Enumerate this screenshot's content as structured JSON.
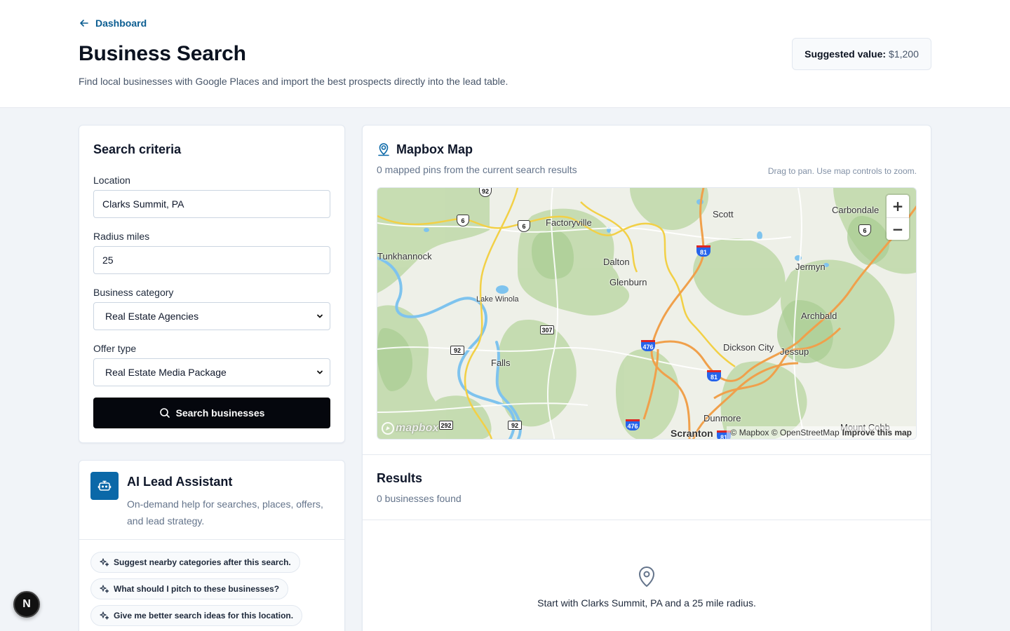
{
  "header": {
    "back_label": "Dashboard",
    "title": "Business Search",
    "subtitle": "Find local businesses with Google Places and import the best prospects directly into the lead table.",
    "suggested_label": "Suggested value:",
    "suggested_value": "$1,200"
  },
  "criteria": {
    "title": "Search criteria",
    "location_label": "Location",
    "location_value": "Clarks Summit, PA",
    "radius_label": "Radius miles",
    "radius_value": "25",
    "category_label": "Business category",
    "category_value": "Real Estate Agencies",
    "offer_label": "Offer type",
    "offer_value": "Real Estate Media Package",
    "search_button": "Search businesses"
  },
  "assistant": {
    "title": "AI Lead Assistant",
    "description": "On-demand help for searches, places, offers, and lead strategy.",
    "suggestions": [
      "Suggest nearby categories after this search.",
      "What should I pitch to these businesses?",
      "Give me better search ideas for this location."
    ]
  },
  "map": {
    "title": "Mapbox Map",
    "subtitle": "0 mapped pins from the current search results",
    "hint": "Drag to pan. Use map controls to zoom.",
    "zoom_in": "+",
    "zoom_out": "−",
    "logo": "mapbox",
    "attribution": "© Mapbox © OpenStreetMap",
    "improve": "Improve this map",
    "places": [
      "Factoryville",
      "Scott",
      "Carbondale",
      "Tunkhannock",
      "Dalton",
      "Jermyn",
      "Glenburn",
      "Lake Winola",
      "Archbald",
      "Dickson City",
      "Jessup",
      "Falls",
      "Dunmore",
      "Scranton",
      "Mount Cobb"
    ],
    "shields": [
      "92",
      "6",
      "6",
      "81",
      "6",
      "307",
      "92",
      "476",
      "81",
      "476",
      "292",
      "92",
      "81"
    ]
  },
  "results": {
    "title": "Results",
    "count": "0 businesses found",
    "empty_message": "Start with Clarks Summit, PA and a 25 mile radius."
  },
  "badge": {
    "letter": "N"
  }
}
